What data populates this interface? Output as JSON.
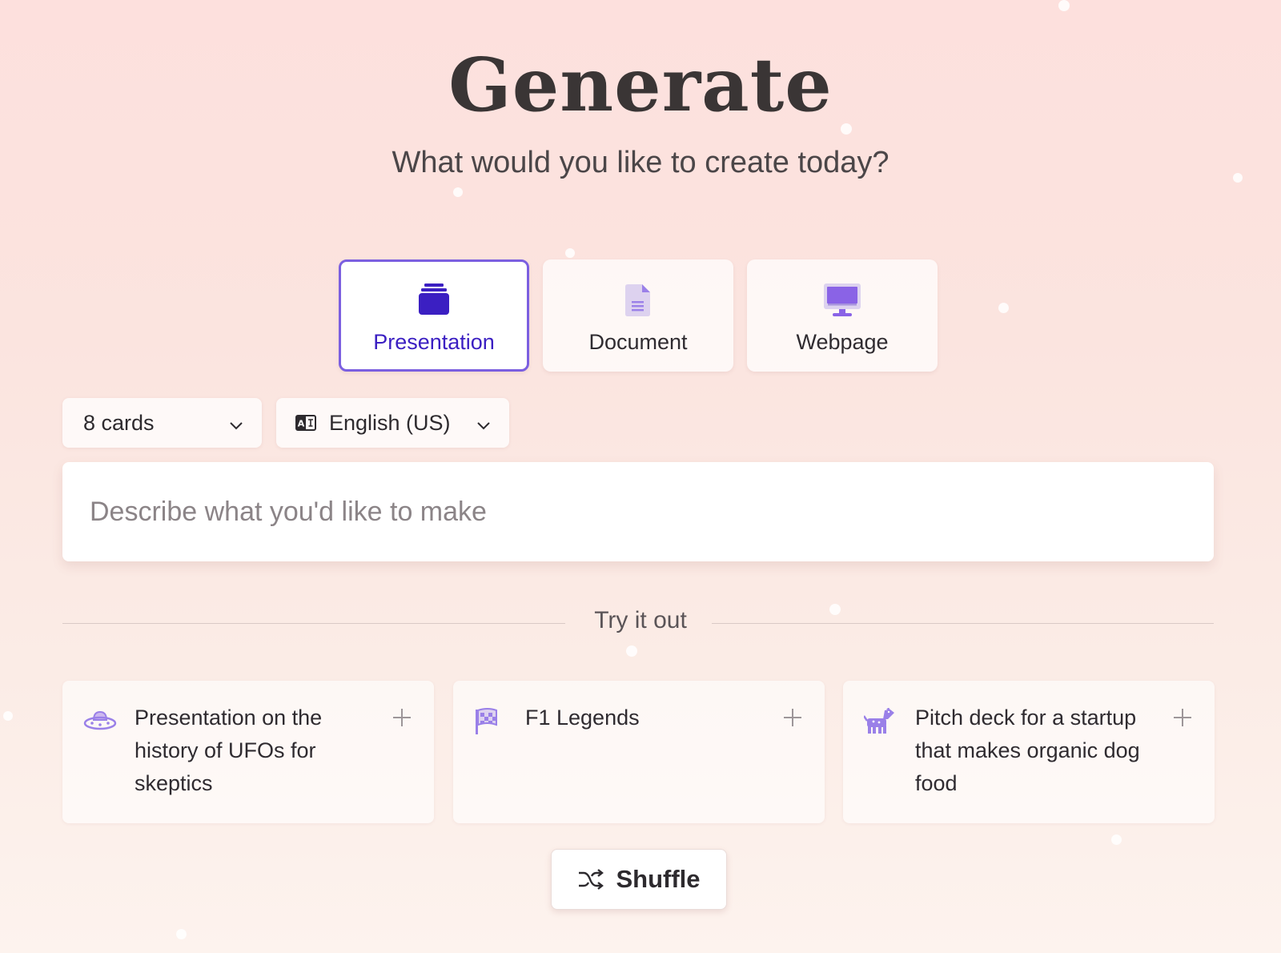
{
  "header": {
    "title": "Generate",
    "subtitle": "What would you like to create today?"
  },
  "content_types": [
    {
      "label": "Presentation",
      "icon": "presentation-stack-icon",
      "selected": true
    },
    {
      "label": "Document",
      "icon": "document-icon",
      "selected": false
    },
    {
      "label": "Webpage",
      "icon": "monitor-icon",
      "selected": false
    }
  ],
  "options": {
    "cards": {
      "value": "8 cards",
      "icon": "chevron-down-icon"
    },
    "language": {
      "value": "English (US)",
      "icon": "translate-icon"
    }
  },
  "prompt": {
    "placeholder": "Describe what you'd like to make",
    "value": ""
  },
  "examples_section": {
    "label": "Try it out",
    "items": [
      {
        "text": "Presentation on the history of UFOs for skeptics",
        "icon": "ufo-icon"
      },
      {
        "text": "F1 Legends",
        "icon": "checkered-flag-icon"
      },
      {
        "text": "Pitch deck for a startup that makes organic dog food",
        "icon": "dog-icon"
      }
    ]
  },
  "shuffle": {
    "label": "Shuffle",
    "icon": "shuffle-icon"
  },
  "colors": {
    "accent": "#7b5fe0",
    "accent_dark": "#3b1fc2",
    "icon_purple": "#9a80e8",
    "background": "#fde0dd"
  }
}
